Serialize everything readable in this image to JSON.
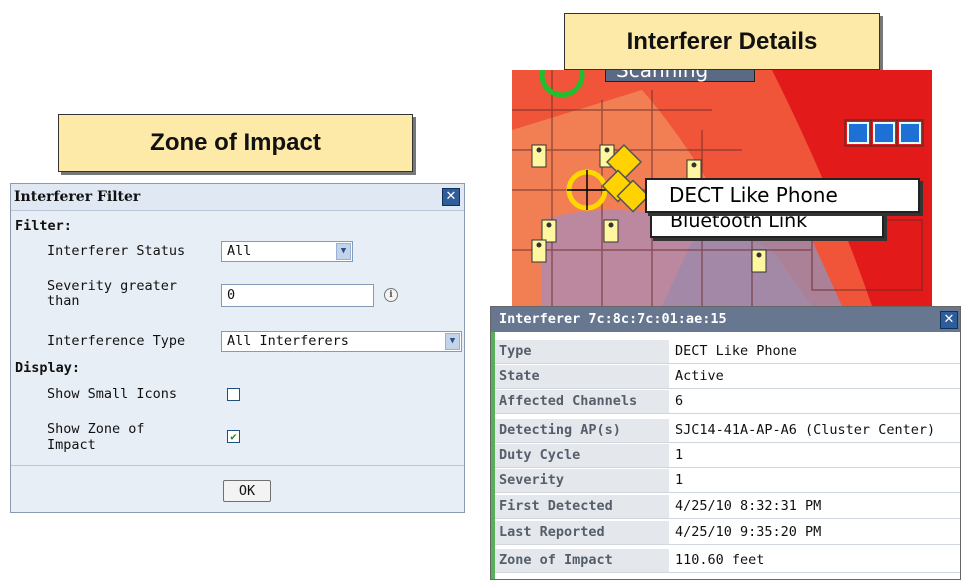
{
  "callouts": {
    "zone_of_impact": "Zone of Impact",
    "interferer_details": "Interferer Details"
  },
  "map": {
    "labels": [
      "Scanning",
      "DECT Like Phone",
      "Bluetooth Link"
    ],
    "colors": {
      "hot": "#e31a1a",
      "warm": "#f06a2a",
      "cool": "#b9a3b8"
    }
  },
  "filter_dialog": {
    "title": "Interferer Filter",
    "close_icon": "close-icon",
    "filter_section": "Filter:",
    "status_label": "Interferer Status",
    "status_value": "All",
    "severity_label_1": "Severity greater",
    "severity_label_2": "than",
    "severity_value": "0",
    "info_icon": "info-icon",
    "type_label": "Interference Type",
    "type_value": "All Interferers",
    "display_section": "Display:",
    "small_icons_label": "Show Small Icons",
    "small_icons_checked": false,
    "zone_label_1": "Show Zone of",
    "zone_label_2": "Impact",
    "zone_checked": true,
    "ok_label": "OK"
  },
  "details_panel": {
    "title": "Interferer 7c:8c:7c:01:ae:15",
    "rows": [
      {
        "key": "Type",
        "value": "DECT Like Phone"
      },
      {
        "key": "State",
        "value": "Active"
      },
      {
        "key": "Affected Channels",
        "value": "6"
      },
      {
        "key": "Detecting AP(s)",
        "value": "SJC14-41A-AP-A6 (Cluster Center)"
      },
      {
        "key": "Duty Cycle",
        "value": "1"
      },
      {
        "key": "Severity",
        "value": "1"
      },
      {
        "key": "First Detected",
        "value": "4/25/10 8:32:31 PM"
      },
      {
        "key": "Last Reported",
        "value": "4/25/10 9:35:20 PM"
      },
      {
        "key": "Zone of Impact",
        "value": "110.60 feet"
      }
    ]
  }
}
